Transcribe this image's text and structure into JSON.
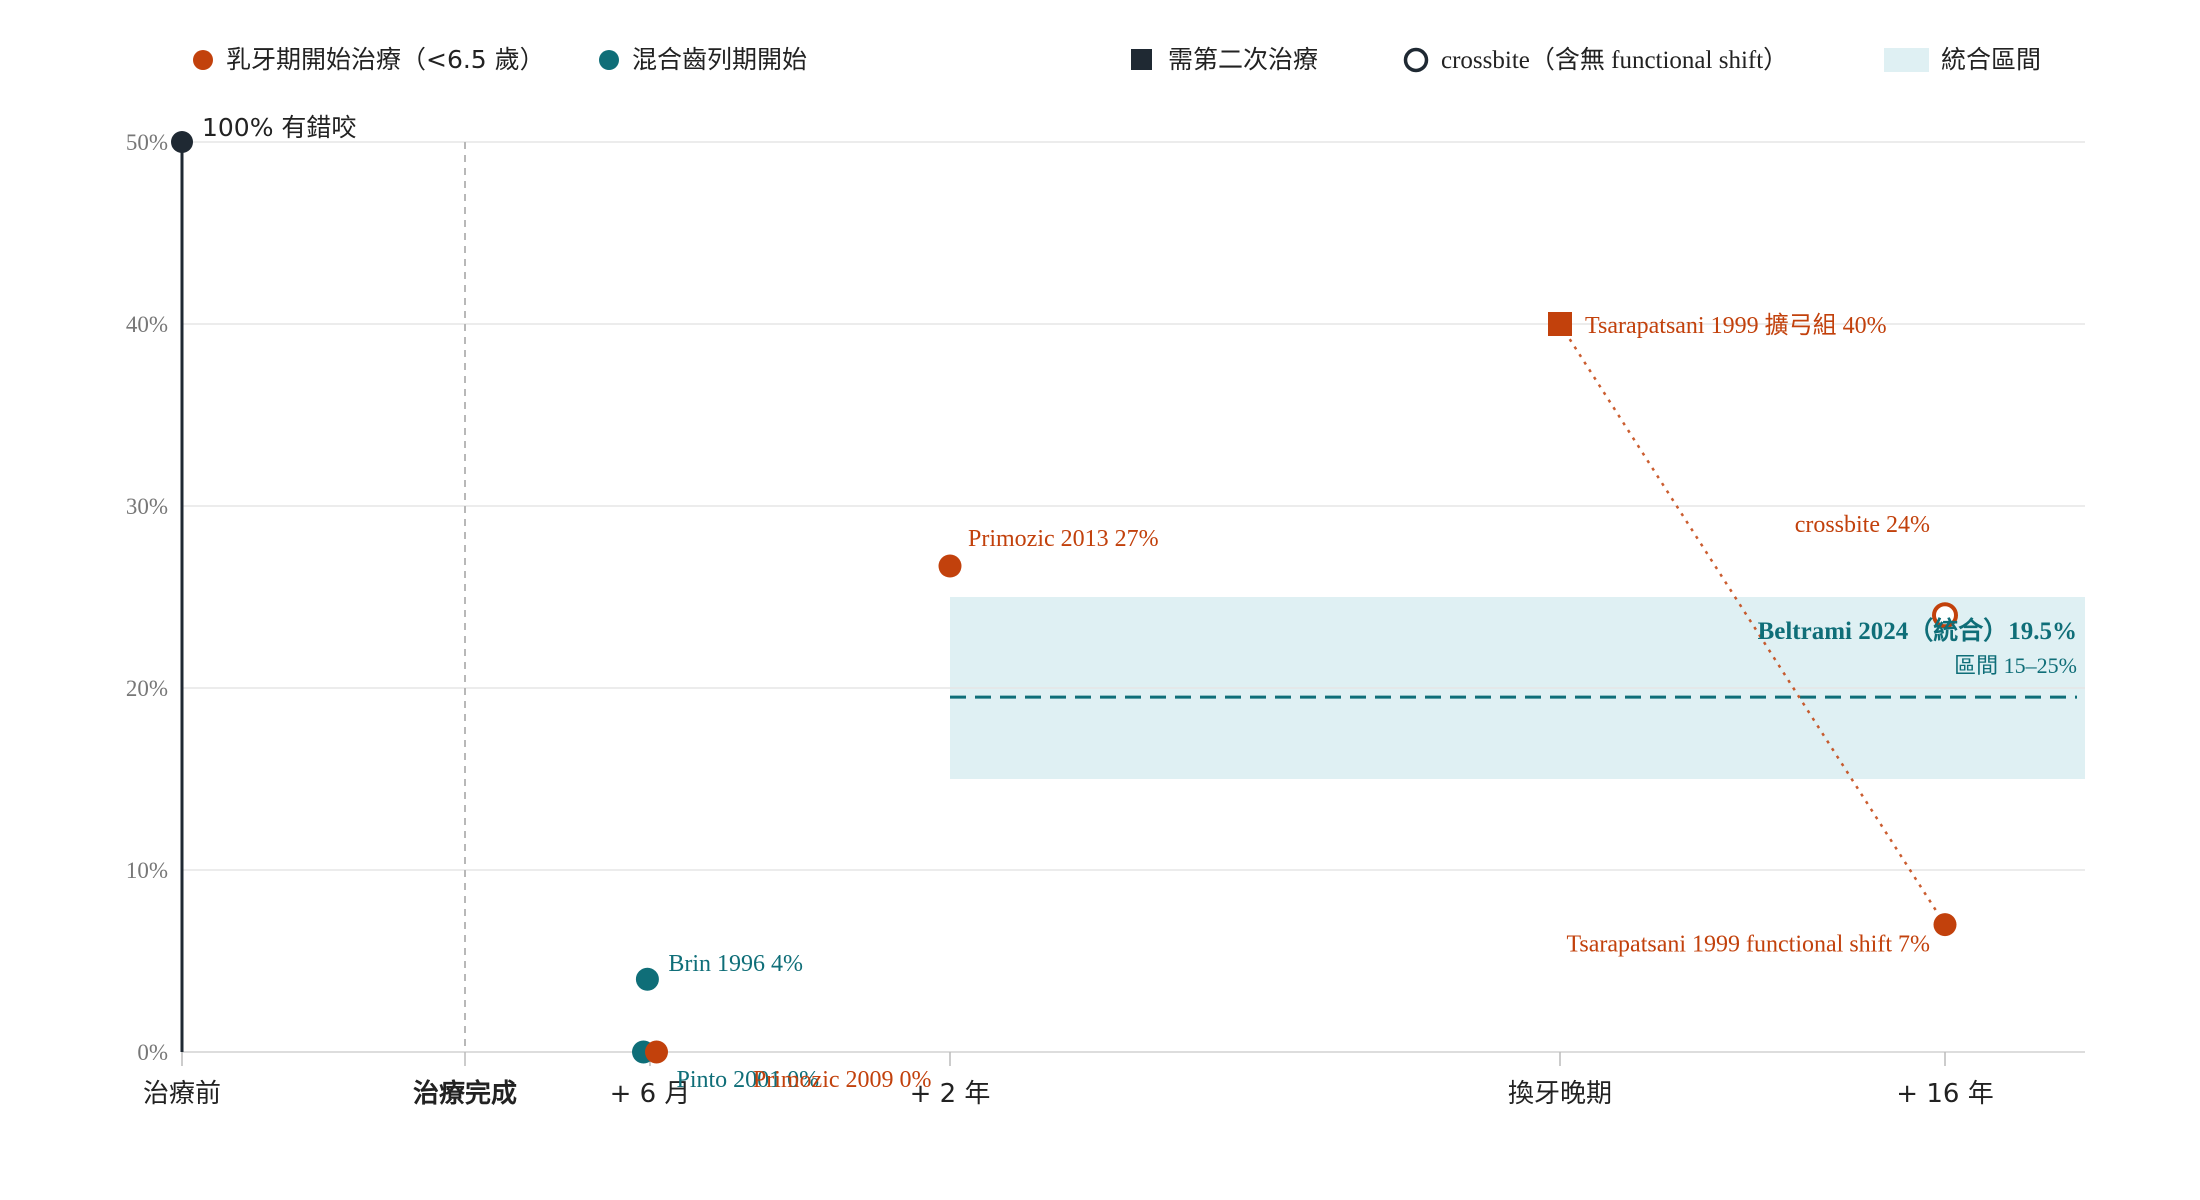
{
  "colors": {
    "primary": "#c2410c",
    "mixed": "#0f6e78",
    "dark": "#1f2933",
    "band": "#dff0f3",
    "grid": "#e6e6e6",
    "tick_text": "#777777"
  },
  "legend": [
    {
      "label": "乳牙期開始治療（<6.5 歲）",
      "marker": "circle",
      "color": "#c2410c"
    },
    {
      "label": "混合齒列期開始",
      "marker": "circle",
      "color": "#0f6e78"
    },
    {
      "label": "需第二次治療",
      "marker": "square",
      "color": "#1f2933"
    },
    {
      "label": "crossbite（含無 functional shift）",
      "marker": "open-circle",
      "color": "#1f2933"
    },
    {
      "label": "統合區間",
      "marker": "band",
      "color": "#dff0f3"
    }
  ],
  "chart_data": {
    "type": "scatter",
    "x_categories": [
      "治療前",
      "治療完成",
      "+ 6 月",
      "+ 2 年",
      "換牙晚期",
      "+ 16 年"
    ],
    "x_emphasis": "治療完成",
    "ylim": [
      0,
      50
    ],
    "yticks": [
      0,
      10,
      20,
      30,
      40,
      50
    ],
    "ytick_labels": [
      "0%",
      "10%",
      "20%",
      "30%",
      "40%",
      "50%"
    ],
    "grid": true,
    "baseline": {
      "x": "治療前",
      "value": 50,
      "label": "100% 有錯咬"
    },
    "points": [
      {
        "x": "+ 6 月",
        "offset": -0.05,
        "value": 0,
        "group": "mixed",
        "marker": "circle",
        "label": "Pinto 2001 0%"
      },
      {
        "x": "+ 6 月",
        "offset": 0.05,
        "value": 0,
        "group": "primary",
        "marker": "circle",
        "label": "Primozic 2009 0%"
      },
      {
        "x": "+ 6 月",
        "offset": -0.02,
        "value": 4,
        "group": "mixed",
        "marker": "circle",
        "label": "Brin 1996 4%"
      },
      {
        "x": "+ 2 年",
        "offset": 0,
        "value": 26.7,
        "group": "primary",
        "marker": "circle",
        "label": "Primozic 2013 27%"
      },
      {
        "x": "換牙晚期",
        "offset": 0,
        "value": 40,
        "group": "primary",
        "marker": "square",
        "label": "Tsarapatsani 1999 擴弓組 40%"
      },
      {
        "x": "+ 16 年",
        "offset": 0,
        "value": 24,
        "group": "primary",
        "marker": "open-circle",
        "label": "crossbite 24%"
      },
      {
        "x": "+ 16 年",
        "offset": 0,
        "value": 7,
        "group": "primary",
        "marker": "circle",
        "label": "Tsarapatsani 1999 functional shift 7%"
      }
    ],
    "connector": {
      "from_label": "Tsarapatsani 1999 擴弓組 40%",
      "to_label": "Tsarapatsani 1999 functional shift 7%"
    },
    "pooled": {
      "label": "Beltrami 2024（統合）19.5%",
      "range_label": "區間 15–25%",
      "value": 19.5,
      "low": 15,
      "high": 25,
      "x_start": "+ 2 年"
    }
  }
}
